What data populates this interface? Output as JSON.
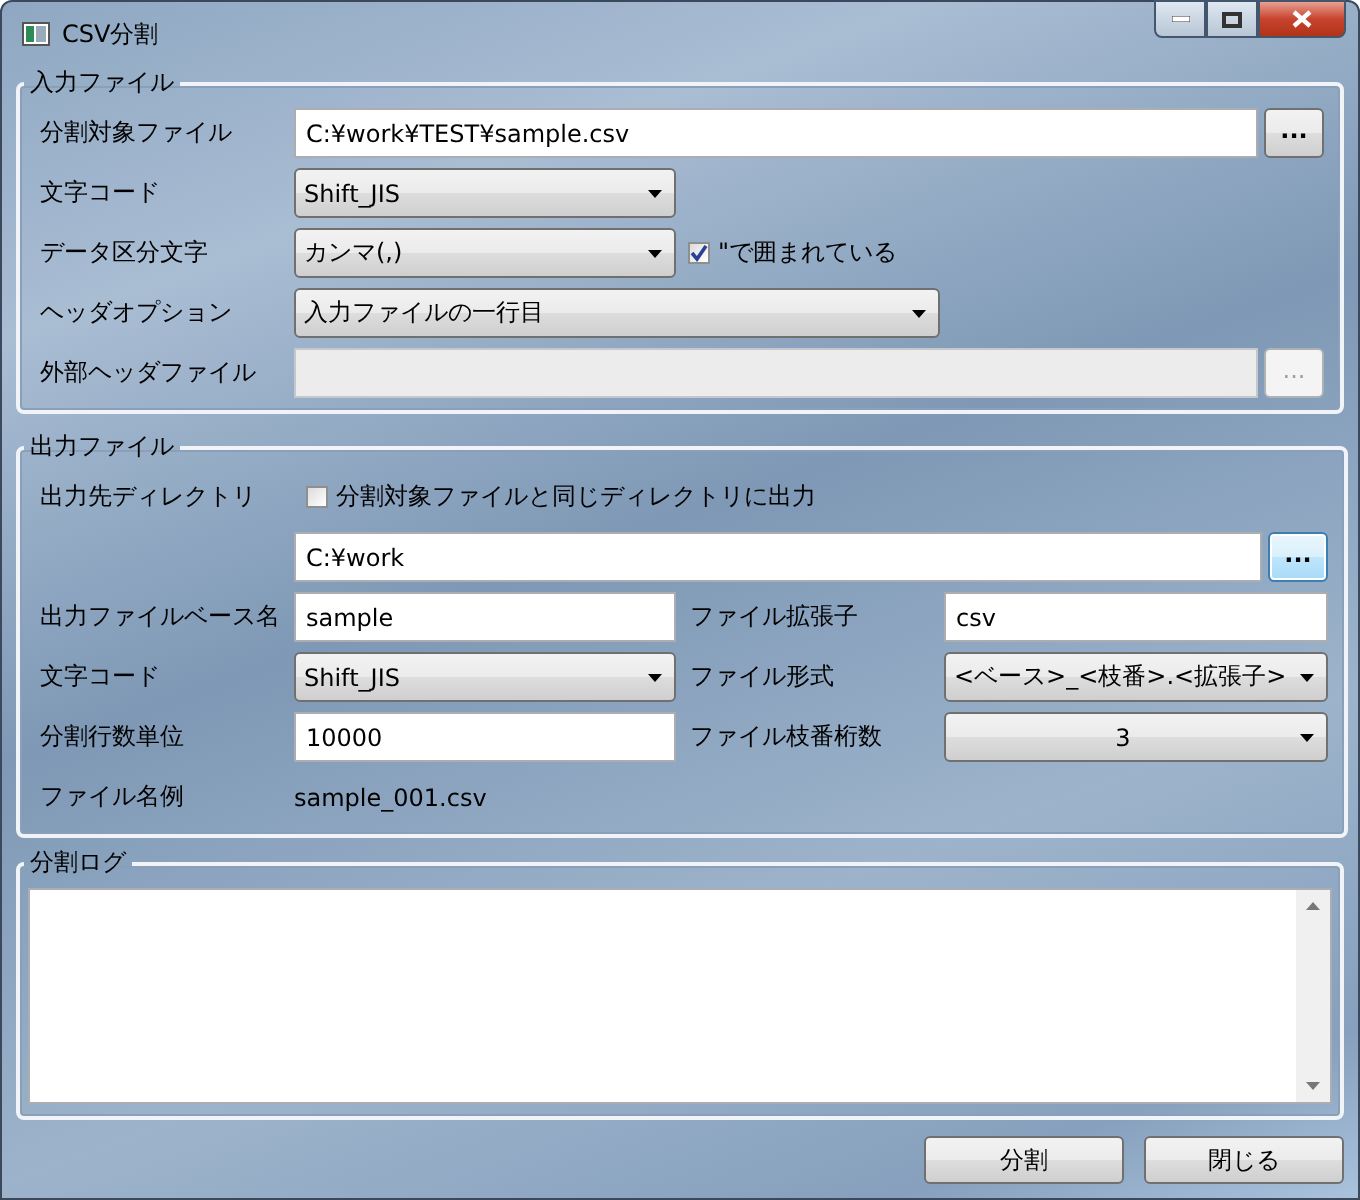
{
  "window": {
    "title": "CSV分割"
  },
  "input_group": {
    "title": "入力ファイル",
    "rows": [
      {
        "kind": "path",
        "label": "分割対象ファイル",
        "value": "C:¥work¥TEST¥sample.csv",
        "disabled": false,
        "browse": {
          "label": "...",
          "disabled": false,
          "focused": false
        }
      },
      {
        "kind": "short-select",
        "label": "文字コード",
        "value": "Shift_JIS"
      },
      {
        "kind": "short-select",
        "label": "データ区分文字",
        "value": "カンマ(,)",
        "checkbox": {
          "label": "\"で囲まれている",
          "checked": true
        }
      },
      {
        "kind": "wide-select",
        "label": "ヘッダオプション",
        "value": "入力ファイルの一行目"
      },
      {
        "kind": "path",
        "label": "外部ヘッダファイル",
        "disabled": true,
        "browse": {
          "label": "...",
          "disabled": true,
          "focused": false
        }
      }
    ]
  },
  "output_group": {
    "title": "出力ファイル",
    "directory": {
      "label": "出力先ディレクトリ",
      "checkbox": {
        "label": "分割対象ファイルと同じディレクトリに出力",
        "checked": false
      },
      "value": "C:¥work",
      "browse": {
        "label": "...",
        "disabled": false,
        "focused": true
      }
    },
    "fields": [
      {
        "kind": "text",
        "label": "出力ファイルベース名",
        "value": "sample"
      },
      {
        "kind": "text",
        "label": "ファイル拡張子",
        "value": "csv"
      },
      {
        "kind": "select",
        "label": "文字コード",
        "value": "Shift_JIS"
      },
      {
        "kind": "select",
        "label": "ファイル形式",
        "value": "<ベース>_<枝番>.<拡張子>"
      },
      {
        "kind": "text",
        "label": "分割行数単位",
        "value": "10000"
      },
      {
        "kind": "centered-select",
        "label": "ファイル枝番桁数",
        "value": "3"
      }
    ],
    "example": {
      "label": "ファイル名例",
      "value": "sample_001.csv"
    }
  },
  "log_group": {
    "title": "分割ログ"
  },
  "buttons": [
    "分割",
    "閉じる"
  ]
}
